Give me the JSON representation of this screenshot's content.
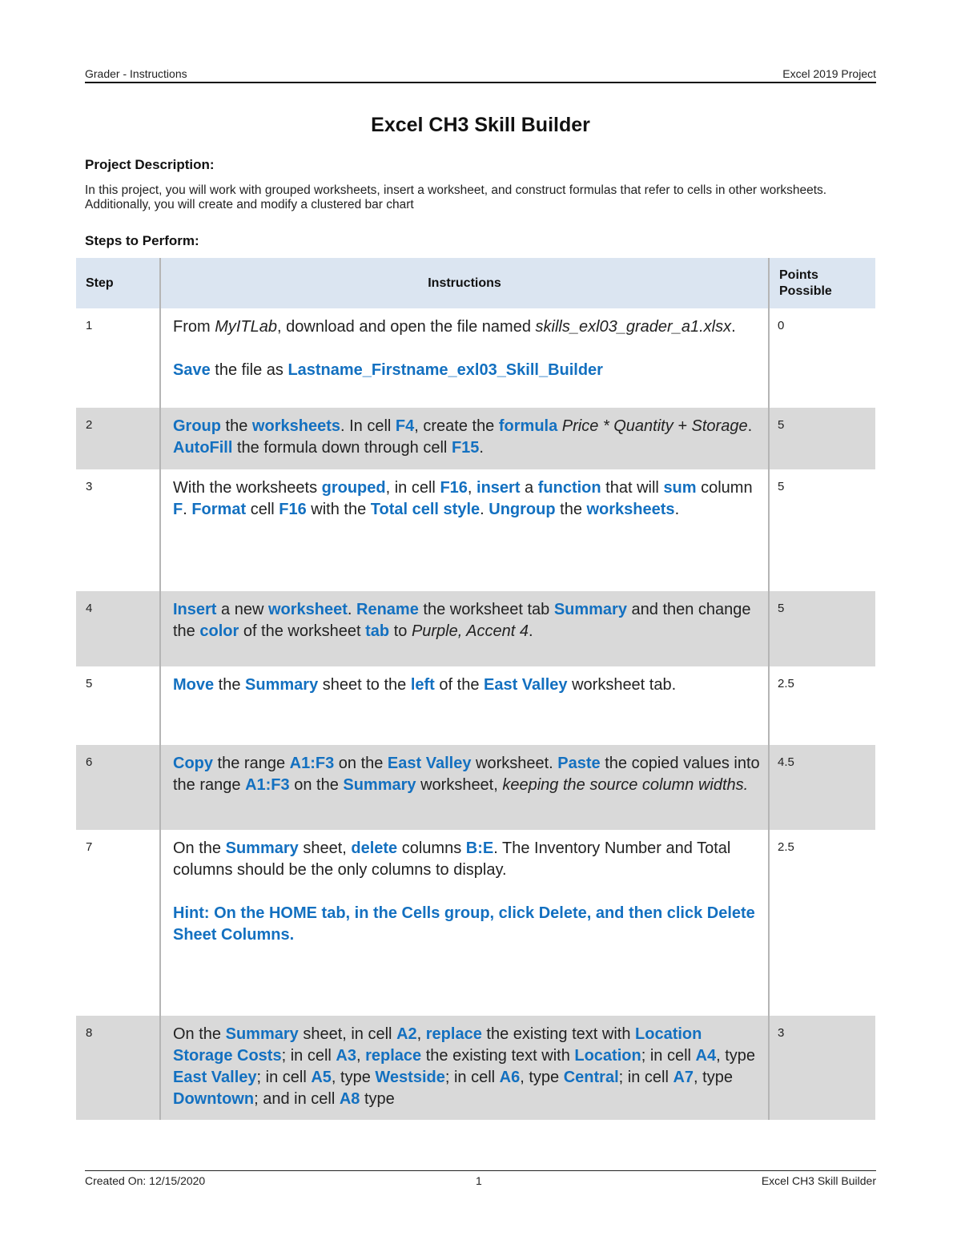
{
  "header": {
    "left": "Grader - Instructions",
    "right": "Excel 2019 Project"
  },
  "title": "Excel CH3 Skill Builder",
  "project_description": {
    "heading": "Project Description:",
    "text": " In this project, you will work with grouped worksheets, insert a worksheet, and construct formulas that refer to cells in other worksheets. Additionally, you will create and modify a clustered bar chart"
  },
  "steps_heading": "Steps to Perform:",
  "table": {
    "columns": {
      "step": "Step",
      "instructions": "Instructions",
      "points_line1": "Points",
      "points_line2": "Possible"
    },
    "rows": [
      {
        "step": "1",
        "points": "0",
        "paragraphs": [
          [
            {
              "t": "From "
            },
            {
              "t": "MyITLab",
              "s": "i"
            },
            {
              "t": ", download and open the file named "
            },
            {
              "t": "skills_exl03_grader_a1.xlsx",
              "s": "i"
            },
            {
              "t": "."
            }
          ],
          [
            {
              "t": "Save",
              "s": "b"
            },
            {
              "t": " the file as "
            },
            {
              "t": "Lastname_Firstname_exl03_Skill_Builder",
              "s": "b"
            }
          ]
        ]
      },
      {
        "step": "2",
        "points": "5",
        "paragraphs": [
          [
            {
              "t": "Group",
              "s": "b"
            },
            {
              "t": " the "
            },
            {
              "t": "worksheets",
              "s": "b"
            },
            {
              "t": ". In cell "
            },
            {
              "t": "F4",
              "s": "b"
            },
            {
              "t": ", create the "
            },
            {
              "t": "formula",
              "s": "b"
            },
            {
              "t": " "
            },
            {
              "t": "Price * Quantity + Storage",
              "s": "i"
            },
            {
              "t": ". "
            },
            {
              "t": "AutoFill",
              "s": "b"
            },
            {
              "t": " the formula down through cell "
            },
            {
              "t": "F15",
              "s": "b"
            },
            {
              "t": "."
            }
          ]
        ]
      },
      {
        "step": "3",
        "points": "5",
        "paragraphs": [
          [
            {
              "t": "With the worksheets "
            },
            {
              "t": "grouped",
              "s": "b"
            },
            {
              "t": ", in cell "
            },
            {
              "t": "F16",
              "s": "b"
            },
            {
              "t": ", "
            },
            {
              "t": "insert",
              "s": "b"
            },
            {
              "t": " a "
            },
            {
              "t": "function",
              "s": "b"
            },
            {
              "t": " that will "
            },
            {
              "t": "sum",
              "s": "b"
            },
            {
              "t": " column "
            },
            {
              "t": "F",
              "s": "b"
            },
            {
              "t": ". "
            },
            {
              "t": "Format",
              "s": "b"
            },
            {
              "t": " cell "
            },
            {
              "t": "F16",
              "s": "b"
            },
            {
              "t": " with the "
            },
            {
              "t": "Total cell style",
              "s": "b"
            },
            {
              "t": ".  "
            },
            {
              "t": "Ungroup",
              "s": "b"
            },
            {
              "t": " the "
            },
            {
              "t": "worksheets",
              "s": "b"
            },
            {
              "t": "."
            }
          ]
        ]
      },
      {
        "step": "4",
        "points": "5",
        "paragraphs": [
          [
            {
              "t": "Insert",
              "s": "b"
            },
            {
              "t": " a new "
            },
            {
              "t": "worksheet",
              "s": "b"
            },
            {
              "t": ". "
            },
            {
              "t": "Rename",
              "s": "b"
            },
            {
              "t": " the worksheet tab "
            },
            {
              "t": "Summary",
              "s": "b"
            },
            {
              "t": " and then change the "
            },
            {
              "t": "color",
              "s": "b"
            },
            {
              "t": " of the worksheet "
            },
            {
              "t": "tab",
              "s": "b"
            },
            {
              "t": " to "
            },
            {
              "t": "Purple, Accent 4",
              "s": "i"
            },
            {
              "t": "."
            }
          ]
        ]
      },
      {
        "step": "5",
        "points": "2.5",
        "paragraphs": [
          [
            {
              "t": "Move",
              "s": "b"
            },
            {
              "t": " the "
            },
            {
              "t": "Summary",
              "s": "b"
            },
            {
              "t": " sheet to the "
            },
            {
              "t": "left",
              "s": "b"
            },
            {
              "t": " of the "
            },
            {
              "t": "East Valley",
              "s": "b"
            },
            {
              "t": " worksheet tab."
            }
          ]
        ]
      },
      {
        "step": "6",
        "points": "4.5",
        "paragraphs": [
          [
            {
              "t": "Copy",
              "s": "b"
            },
            {
              "t": " the range "
            },
            {
              "t": "A1:F3",
              "s": "b"
            },
            {
              "t": " on the "
            },
            {
              "t": "East Valley",
              "s": "b"
            },
            {
              "t": " worksheet. "
            },
            {
              "t": "Paste",
              "s": "b"
            },
            {
              "t": " the copied values into the range "
            },
            {
              "t": "A1:F3",
              "s": "b"
            },
            {
              "t": " on the "
            },
            {
              "t": "Summary",
              "s": "b"
            },
            {
              "t": " worksheet, "
            },
            {
              "t": "keeping the source column widths.",
              "s": "i"
            }
          ]
        ]
      },
      {
        "step": "7",
        "points": "2.5",
        "paragraphs": [
          [
            {
              "t": "On the "
            },
            {
              "t": "Summary",
              "s": "b"
            },
            {
              "t": " sheet, "
            },
            {
              "t": "delete",
              "s": "b"
            },
            {
              "t": " columns "
            },
            {
              "t": "B:E",
              "s": "b"
            },
            {
              "t": ". The Inventory Number and Total columns should be the only columns to display."
            }
          ],
          [
            {
              "t": "Hint: On the HOME tab, in the Cells group, click Delete, and then click Delete Sheet Columns.",
              "s": "b"
            }
          ]
        ]
      },
      {
        "step": "8",
        "points": "3",
        "paragraphs": [
          [
            {
              "t": "On the "
            },
            {
              "t": "Summary",
              "s": "b"
            },
            {
              "t": " sheet, in cell "
            },
            {
              "t": "A2",
              "s": "b"
            },
            {
              "t": ", "
            },
            {
              "t": "replace",
              "s": "b"
            },
            {
              "t": " the existing text with "
            },
            {
              "t": "Location Storage Costs",
              "s": "b"
            },
            {
              "t": "; in cell "
            },
            {
              "t": "A3",
              "s": "b"
            },
            {
              "t": ", "
            },
            {
              "t": "replace",
              "s": "b"
            },
            {
              "t": " the existing text with "
            },
            {
              "t": "Location",
              "s": "b"
            },
            {
              "t": "; in cell "
            },
            {
              "t": "A4",
              "s": "b"
            },
            {
              "t": ", type "
            },
            {
              "t": "East Valley",
              "s": "b"
            },
            {
              "t": "; in cell "
            },
            {
              "t": "A5",
              "s": "b"
            },
            {
              "t": ", type "
            },
            {
              "t": "Westside",
              "s": "b"
            },
            {
              "t": "; in cell "
            },
            {
              "t": "A6",
              "s": "b"
            },
            {
              "t": ", type "
            },
            {
              "t": "Central",
              "s": "b"
            },
            {
              "t": "; in cell "
            },
            {
              "t": "A7",
              "s": "b"
            },
            {
              "t": ", type "
            },
            {
              "t": "Downtown",
              "s": "b"
            },
            {
              "t": "; and in cell "
            },
            {
              "t": "A8",
              "s": "b"
            },
            {
              "t": " type"
            }
          ]
        ]
      }
    ]
  },
  "footer": {
    "left": "Created On: 12/15/2020",
    "center": "1",
    "right": "Excel CH3 Skill Builder"
  },
  "colors": {
    "accent_blue": "#1370c0",
    "header_row_bg": "#dbe5f1",
    "alt_row_bg": "#d9d9d9"
  }
}
